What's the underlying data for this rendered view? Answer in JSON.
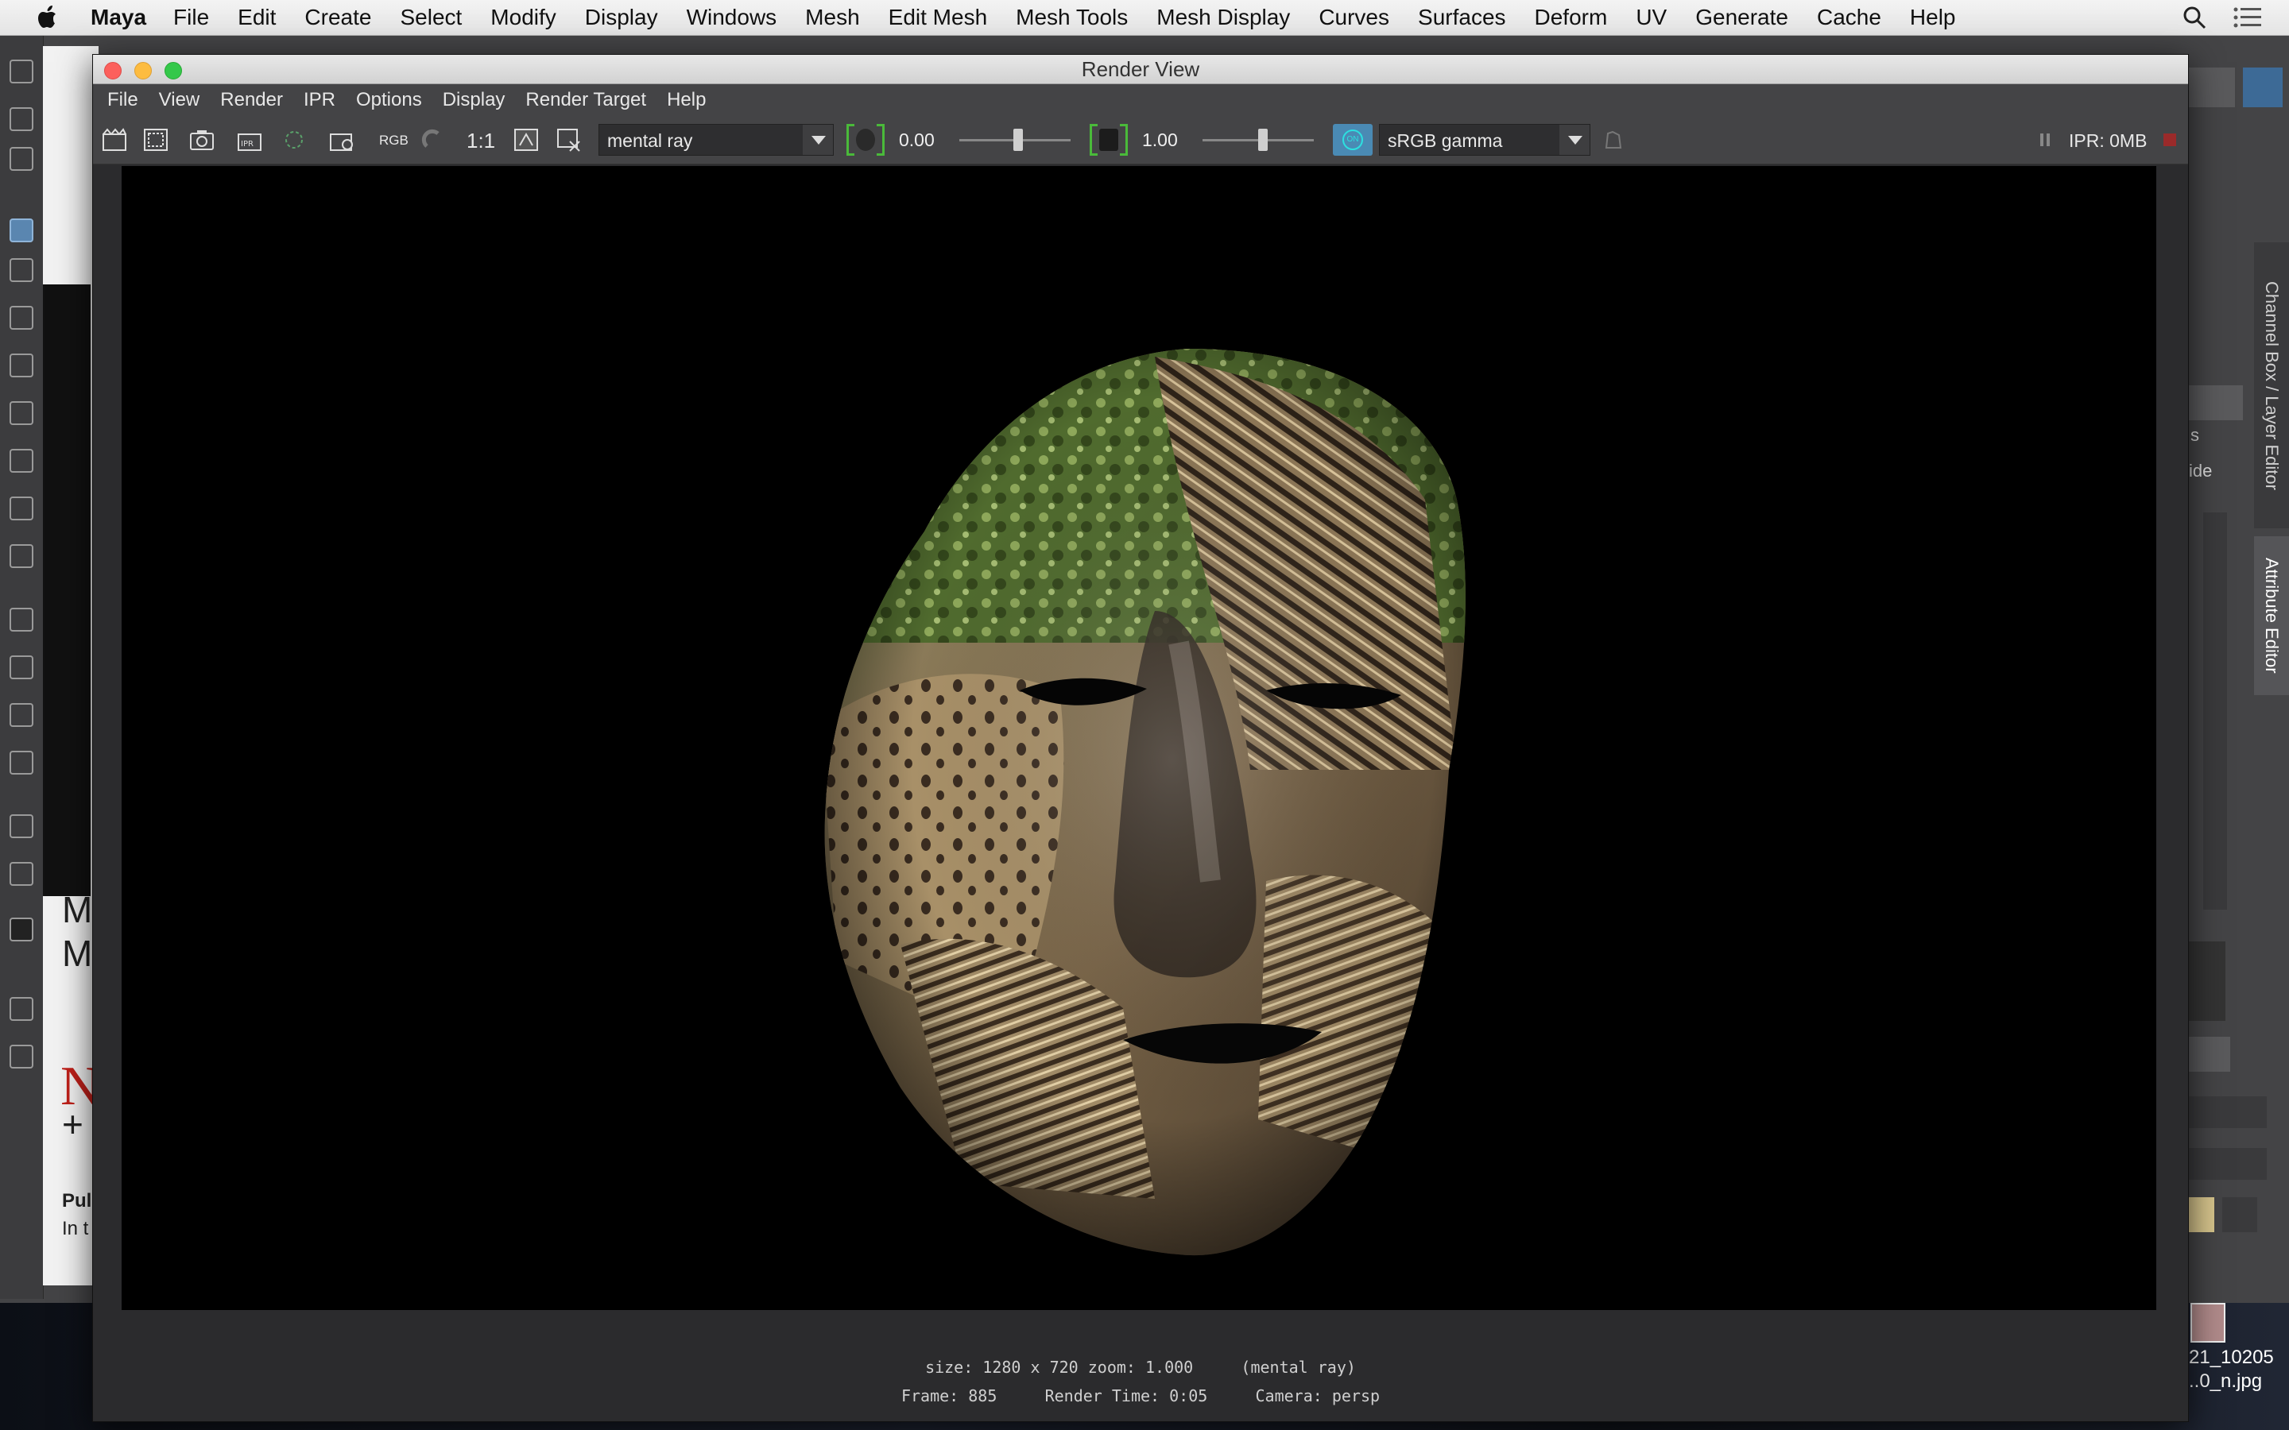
{
  "mac_menubar": {
    "app_name": "Maya",
    "items": [
      "File",
      "Edit",
      "Create",
      "Select",
      "Modify",
      "Display",
      "Windows",
      "Mesh",
      "Edit Mesh",
      "Mesh Tools",
      "Mesh Display",
      "Curves",
      "Surfaces",
      "Deform",
      "UV",
      "Generate",
      "Cache",
      "Help"
    ]
  },
  "render_view": {
    "title": "Render View",
    "menu": [
      "File",
      "View",
      "Render",
      "IPR",
      "Options",
      "Display",
      "Render Target",
      "Help"
    ],
    "toolbar": {
      "rgb_label": "RGB",
      "ratio_label": "1:1",
      "renderer": "mental ray",
      "exposure": "0.00",
      "gamma": "1.00",
      "view_transform": "sRGB gamma",
      "ipr_memory": "IPR: 0MB"
    },
    "status": {
      "size_line": "size: 1280 x 720 zoom: 1.000     (mental ray)",
      "frame_line": "Frame: 885     Render Time: 0:05     Camera: persp"
    }
  },
  "side_panel": {
    "tab_channel_box": "Channel Box / Layer Editor",
    "tab_attribute_editor": "Attribute Editor",
    "field_s": "s",
    "field_ide": "ide"
  },
  "background_browser": {
    "text_1": "M",
    "text_2": "M",
    "text_3": "Pul",
    "text_4": "In t",
    "red_glyph": "N",
    "plus": "+"
  },
  "desktop_file": {
    "name_line1": "21_10205",
    "name_line2": "..0_n.jpg"
  },
  "colors": {
    "accent_blue": "#4a8ab4",
    "bracket_green": "#4aba3a",
    "ui_dark": "#444446",
    "render_bg": "#000000"
  }
}
